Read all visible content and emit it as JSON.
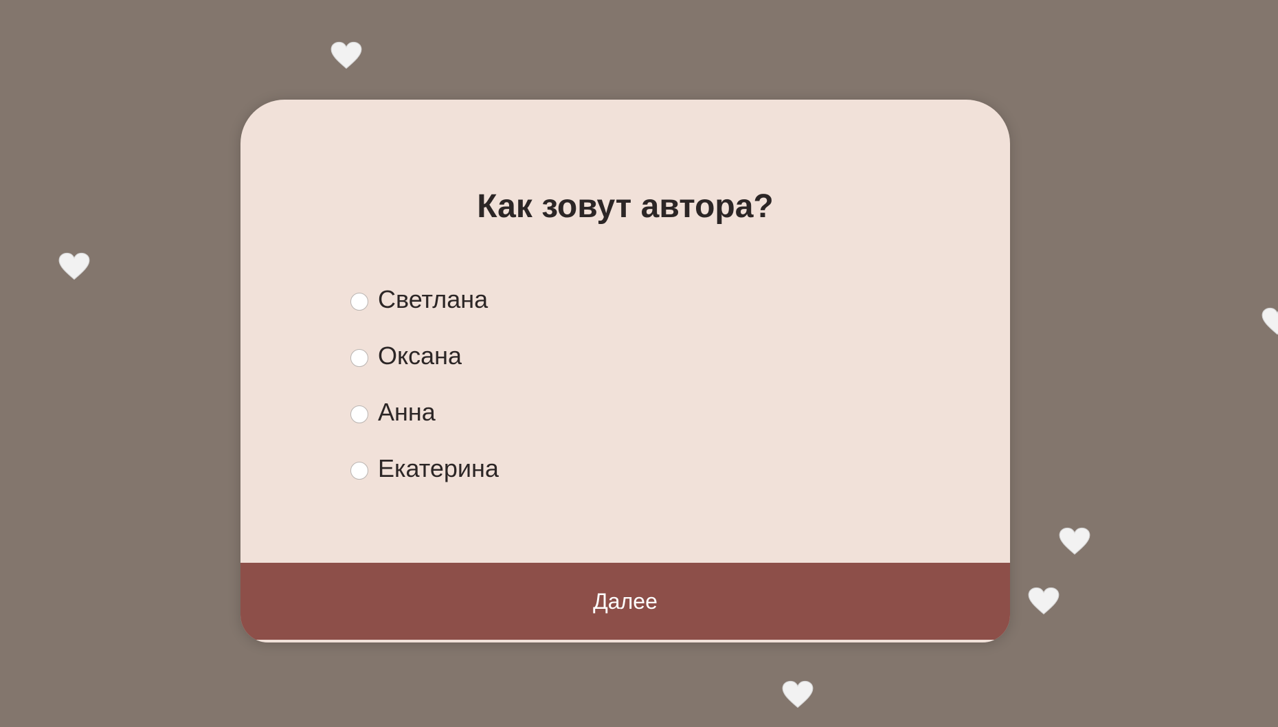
{
  "quiz": {
    "question": "Как зовут автора?",
    "options": [
      {
        "label": "Светлана"
      },
      {
        "label": "Оксана"
      },
      {
        "label": "Анна"
      },
      {
        "label": "Екатерина"
      }
    ],
    "next_label": "Далее"
  },
  "colors": {
    "background": "#83766d",
    "card": "#f1e1d9",
    "button": "#8d4f49",
    "heart": "#f2f2f2"
  },
  "decorations": {
    "icon": "white-heart-icon"
  }
}
